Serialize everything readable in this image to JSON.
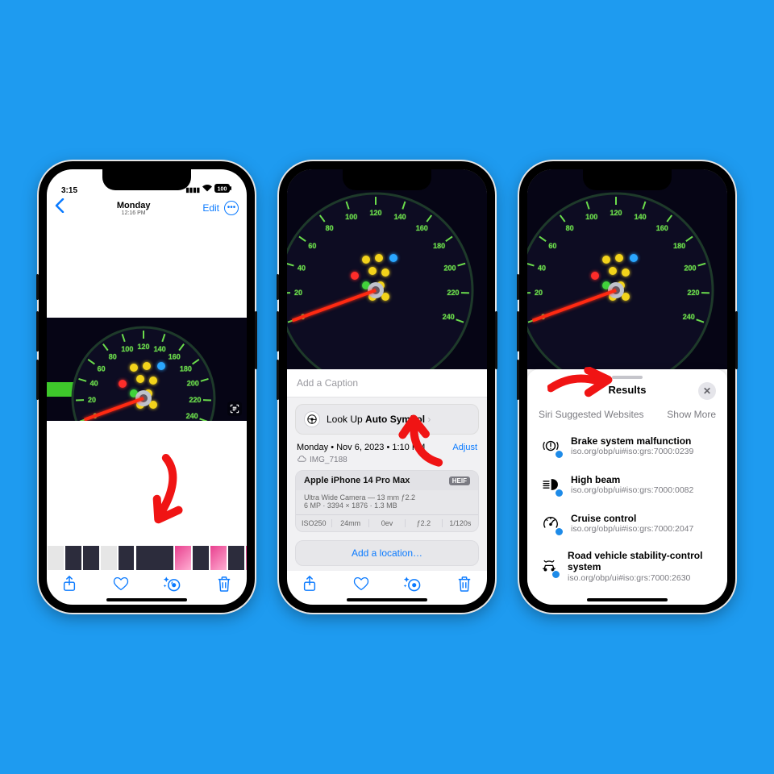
{
  "status": {
    "time": "3:15",
    "battery": "100"
  },
  "screen1": {
    "title_day": "Monday",
    "title_time": "12:16 PM",
    "edit": "Edit"
  },
  "gauge_numbers": [
    "0",
    "20",
    "40",
    "60",
    "80",
    "100",
    "120",
    "140",
    "160",
    "180",
    "200",
    "220",
    "240"
  ],
  "filmstrip_count": 10,
  "sheet2": {
    "caption_placeholder": "Add a Caption",
    "lookup_prefix": "Look Up ",
    "lookup_term": "Auto Symbol",
    "date_line": "Monday • Nov 6, 2023 • 1:10 PM",
    "adjust": "Adjust",
    "filename": "IMG_7188",
    "device": "Apple iPhone 14 Pro Max",
    "badge": "HEIF",
    "lens_line": "Ultra Wide Camera — 13 mm ƒ2.2",
    "size_line": "6 MP · 3394 × 1876 · 1.3 MB",
    "exif": {
      "iso": "ISO250",
      "focal": "24mm",
      "ev": "0ev",
      "fstop": "ƒ2.2",
      "shutter": "1/120s"
    },
    "add_location": "Add a location…"
  },
  "sheet3": {
    "title": "Results",
    "suggested": "Siri Suggested Websites",
    "show_more": "Show More",
    "items": [
      {
        "icon": "brake-warning-icon",
        "title": "Brake system malfunction",
        "sub": "iso.org/obp/ui#iso:grs:7000:0239"
      },
      {
        "icon": "high-beam-icon",
        "title": "High beam",
        "sub": "iso.org/obp/ui#iso:grs:7000:0082"
      },
      {
        "icon": "cruise-control-icon",
        "title": "Cruise control",
        "sub": "iso.org/obp/ui#iso:grs:7000:2047"
      },
      {
        "icon": "stability-control-icon",
        "title": "Road vehicle stability-control system",
        "sub": "iso.org/obp/ui#iso:grs:7000:2630"
      }
    ]
  }
}
